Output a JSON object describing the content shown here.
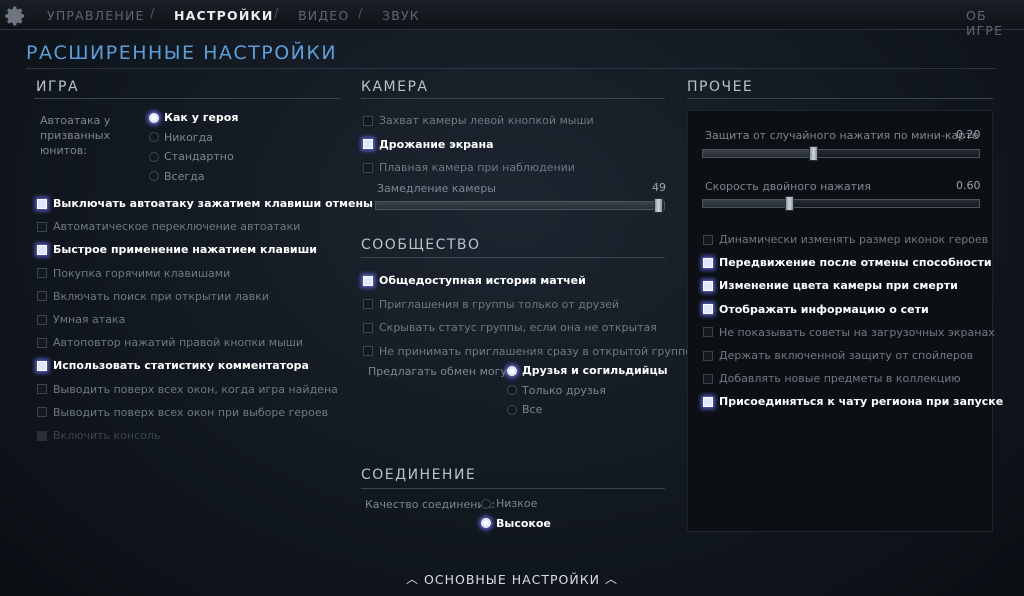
{
  "nav": {
    "tabs": [
      "УПРАВЛЕНИЕ",
      "НАСТРОЙКИ",
      "ВИДЕО",
      "ЗВУК"
    ],
    "separator": "/",
    "about": "ОБ ИГРЕ"
  },
  "page_title": "РАСШИРЕННЫЕ НАСТРОЙКИ",
  "game": {
    "title": "ИГРА",
    "autoattack_label": "Автоатака у призванных юнитов:",
    "autoattack_options": [
      "Как у героя",
      "Никогда",
      "Стандартно",
      "Всегда"
    ],
    "checkboxes": [
      "Выключать автоатаку зажатием клавиши отмены",
      "Автоматическое переключение автоатаки",
      "Быстрое применение нажатием клавиши",
      "Покупка горячими клавишами",
      "Включать поиск при открытии лавки",
      "Умная атака",
      "Автоповтор нажатий правой кнопки мыши",
      "Использовать статистику комментатора",
      "Выводить поверх всех окон, когда игра найдена",
      "Выводить поверх всех окон при выборе героев",
      "Включить консоль"
    ]
  },
  "camera": {
    "title": "КАМЕРА",
    "checkboxes": [
      "Захват камеры левой кнопкой мыши",
      "Дрожание экрана",
      "Плавная камера при наблюдении"
    ],
    "slowdown_label": "Замедление камеры",
    "slowdown_value": "49"
  },
  "community": {
    "title": "СООБЩЕСТВО",
    "checkboxes": [
      "Общедоступная история матчей",
      "Приглашения в группы только от друзей",
      "Скрывать статус группы, если она не открытая",
      "Не принимать приглашения сразу в открытой группе"
    ],
    "trade_label": "Предлагать обмен могут:",
    "trade_options": [
      "Друзья и согильдийцы",
      "Только друзья",
      "Все"
    ]
  },
  "connection": {
    "title": "СОЕДИНЕНИЕ",
    "quality_label": "Качество соединения:",
    "quality_options": [
      "Низкое",
      "Высокое"
    ]
  },
  "other": {
    "title": "ПРОЧЕЕ",
    "minimap_label": "Защита от случайного нажатия по мини-карте",
    "minimap_value": "0.20",
    "doubleclick_label": "Скорость двойного нажатия",
    "doubleclick_value": "0.60",
    "checkboxes": [
      "Динамически изменять размер иконок героев",
      "Передвижение после отмены способности",
      "Изменение цвета камеры при смерти",
      "Отображать информацию о сети",
      "Не показывать советы на загрузочных экранах",
      "Держать включенной защиту от спойлеров",
      "Добавлять новые предметы в коллекцию",
      "Присоединяться к чату региона при запуске"
    ]
  },
  "footer": {
    "label": "ОСНОВНЫЕ НАСТРОЙКИ"
  },
  "state": {
    "game_checked": [
      true,
      false,
      true,
      false,
      false,
      false,
      false,
      true,
      false,
      false,
      false
    ],
    "game_disabled": [
      false,
      false,
      false,
      false,
      false,
      false,
      false,
      false,
      false,
      false,
      true
    ],
    "autoattack_selected": 0,
    "camera_checked": [
      false,
      true,
      false
    ],
    "camera_slowdown_fraction": 0.98,
    "community_checked": [
      true,
      false,
      false,
      false
    ],
    "trade_selected": 0,
    "quality_selected": 1,
    "minimap_fraction": 0.4,
    "doubleclick_fraction": 0.31,
    "other_checked": [
      false,
      true,
      true,
      true,
      false,
      false,
      false,
      true
    ]
  },
  "colors": {
    "accent": "#5d9ed9",
    "glow": "#6e78ff"
  },
  "icons": {
    "settings": "gear-icon",
    "expand": "chevron-up-icon"
  }
}
